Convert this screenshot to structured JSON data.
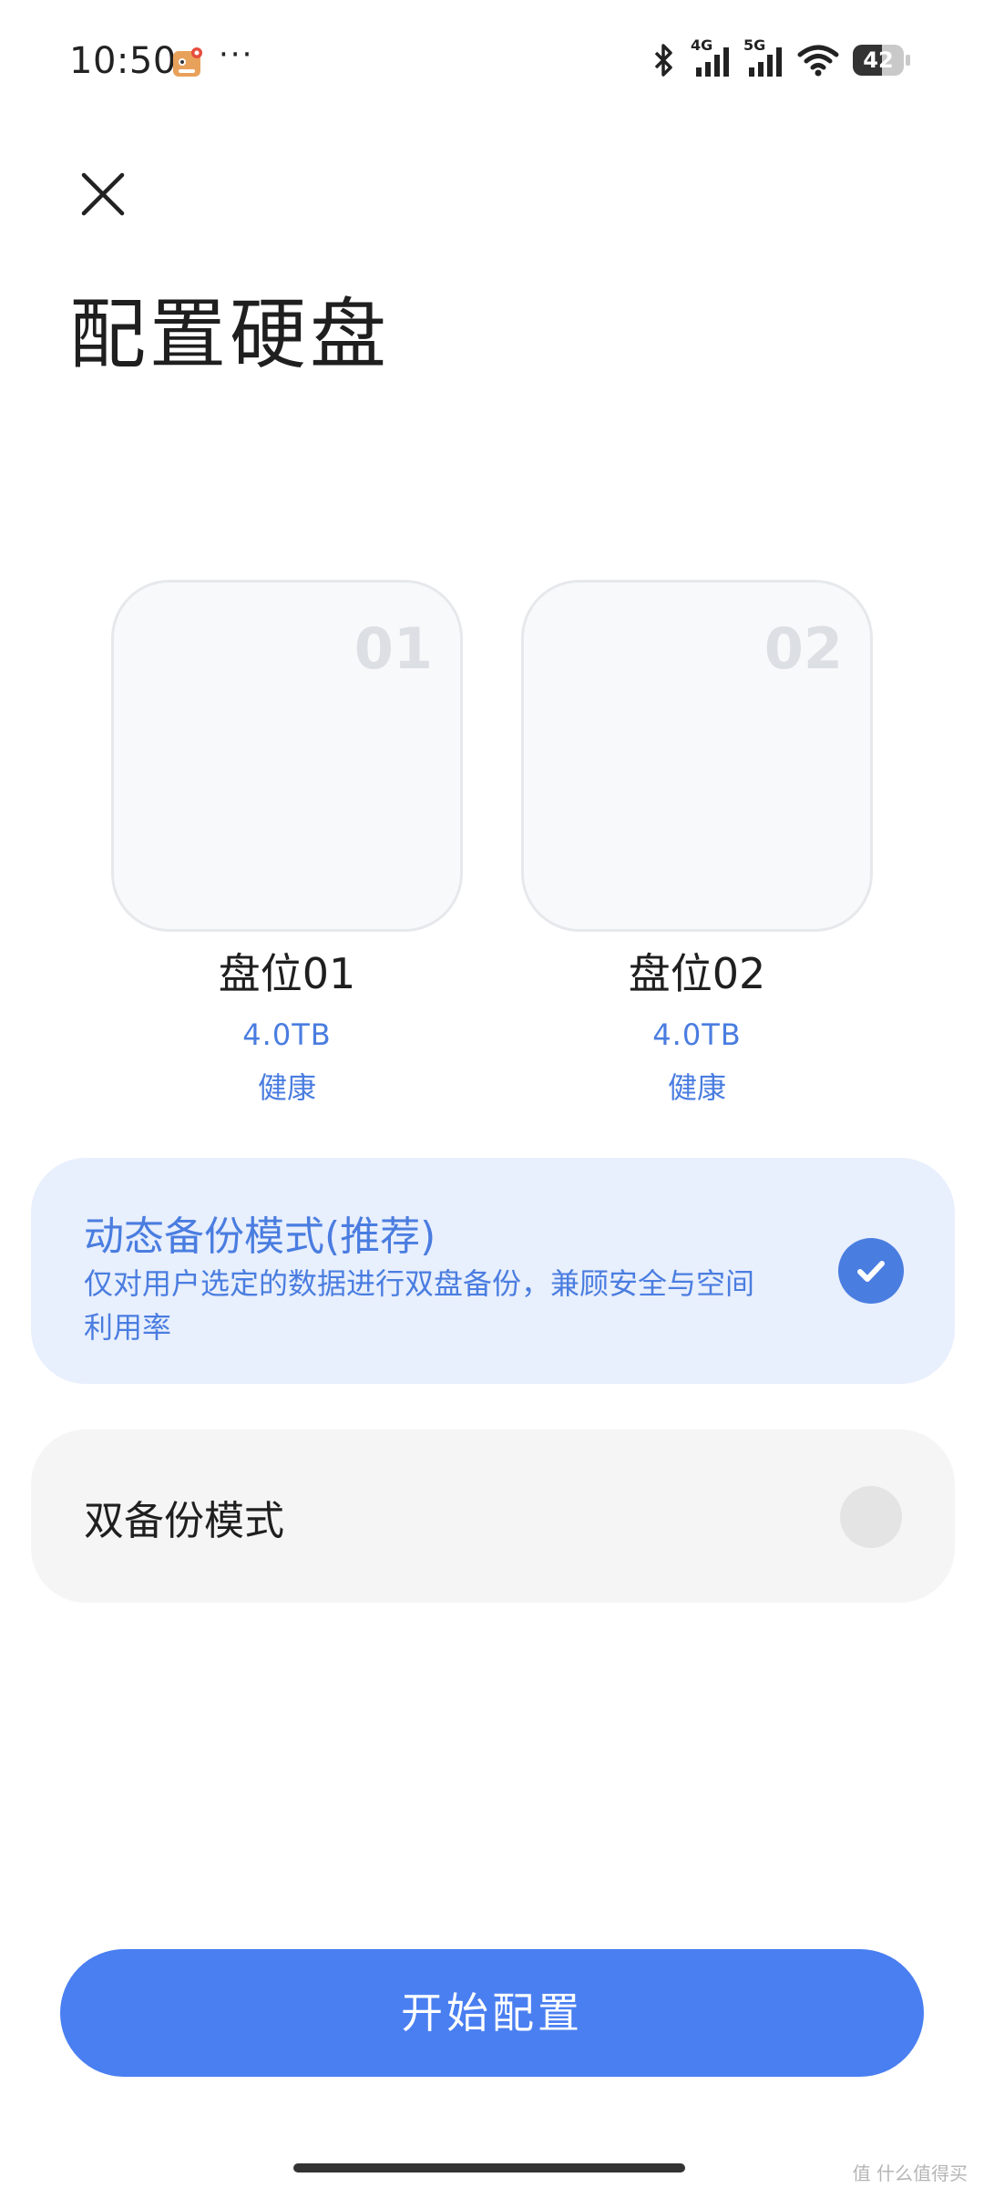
{
  "status_bar": {
    "time": "10:50",
    "more": "···",
    "signal1_label": "4G",
    "signal2_label": "5G",
    "battery_level": "42"
  },
  "header": {
    "title": "配置硬盘"
  },
  "slots": [
    {
      "number": "01",
      "name": "盘位01",
      "capacity": "4.0TB",
      "status": "健康"
    },
    {
      "number": "02",
      "name": "盘位02",
      "capacity": "4.0TB",
      "status": "健康"
    }
  ],
  "modes": [
    {
      "title": "动态备份模式(推荐)",
      "description": "仅对用户选定的数据进行双盘备份，兼顾安全与空间利用率",
      "selected": true
    },
    {
      "title": "双备份模式",
      "selected": false
    }
  ],
  "actions": {
    "start_label": "开始配置"
  },
  "watermark": "值 什么值得买",
  "colors": {
    "accent": "#4a7de0",
    "button": "#4a7ff1",
    "selected_card_bg": "#e8effd"
  }
}
